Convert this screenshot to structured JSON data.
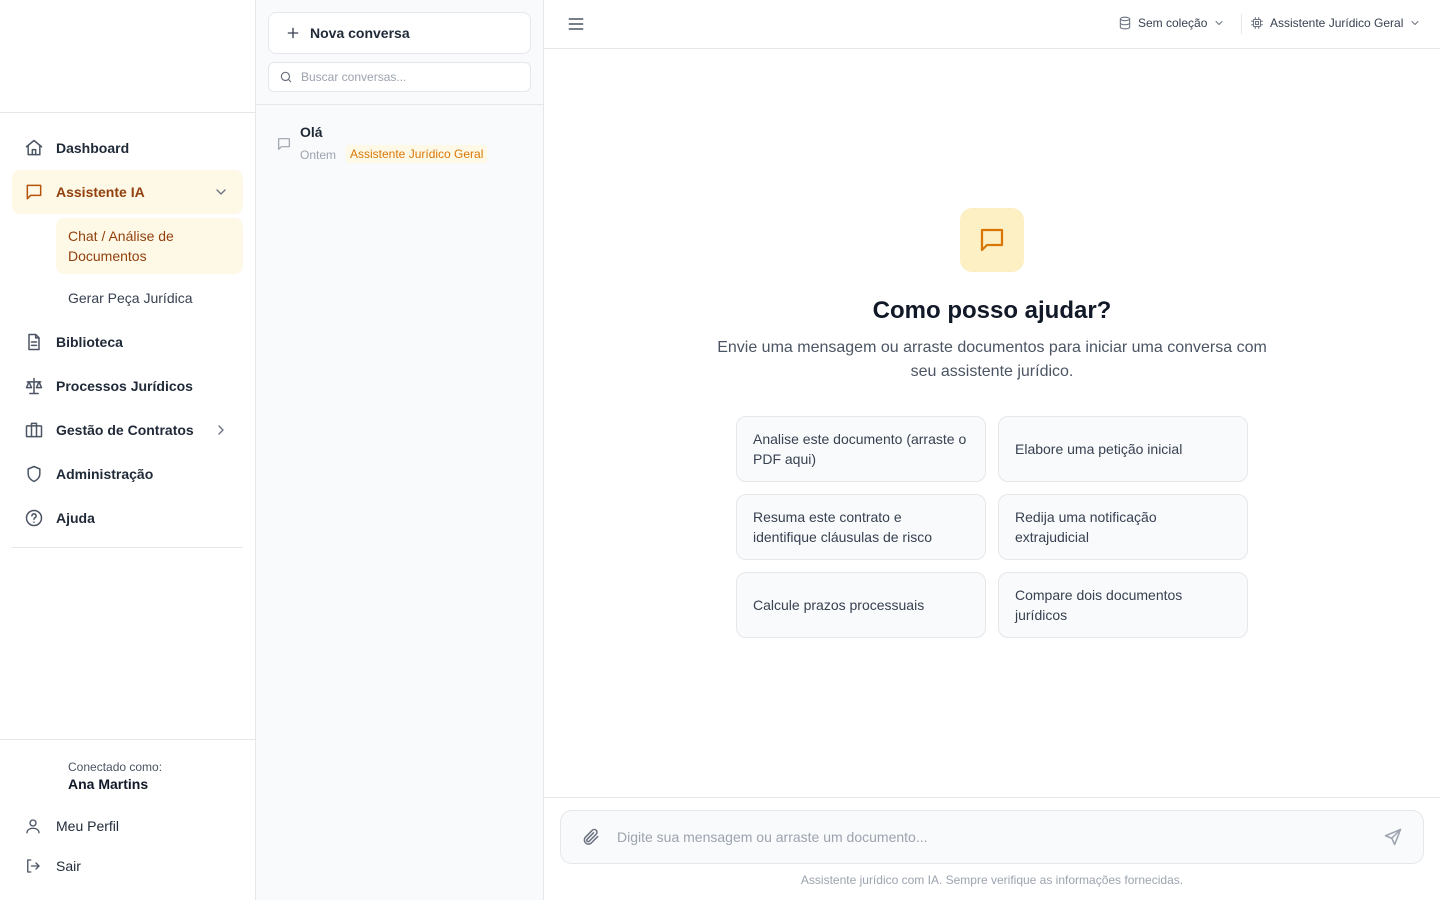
{
  "sidebar": {
    "nav": {
      "dashboard": "Dashboard",
      "assistente": "Assistente IA",
      "sub_chat": "Chat / Análise de Documentos",
      "sub_gerar": "Gerar Peça Jurídica",
      "biblioteca": "Biblioteca",
      "processos": "Processos Jurídicos",
      "contratos": "Gestão de Contratos",
      "administracao": "Administração",
      "ajuda": "Ajuda"
    },
    "user": {
      "caption": "Conectado como:",
      "name": "Ana Martins"
    },
    "footer": {
      "perfil": "Meu Perfil",
      "sair": "Sair"
    }
  },
  "conversations": {
    "new_label": "Nova conversa",
    "search_placeholder": "Buscar conversas...",
    "items": [
      {
        "title": "Olá",
        "date": "Ontem",
        "badge": "Assistente Jurídico Geral"
      }
    ]
  },
  "topbar": {
    "collection": "Sem coleção",
    "assistant": "Assistente Jurídico Geral"
  },
  "welcome": {
    "title": "Como posso ajudar?",
    "subtitle": "Envie uma mensagem ou arraste documentos para iniciar uma conversa com seu assistente jurídico."
  },
  "suggestions": [
    "Analise este documento (arraste o PDF aqui)",
    "Elabore uma petição inicial",
    "Resuma este contrato e identifique cláusulas de risco",
    "Redija uma notificação extrajudicial",
    "Calcule prazos processuais",
    "Compare dois documentos jurídicos"
  ],
  "composer": {
    "placeholder": "Digite sua mensagem ou arraste um documento...",
    "disclaimer": "Assistente jurídico com IA. Sempre verifique as informações fornecidas."
  },
  "colors": {
    "accent": "#d97706",
    "accent_bg": "#fef9e6",
    "accent_text": "#92400e"
  }
}
